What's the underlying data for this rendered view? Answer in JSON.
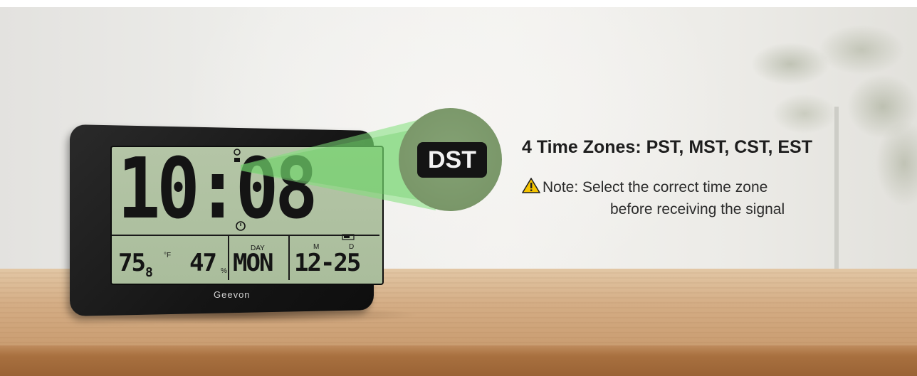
{
  "clock": {
    "time": "10:08",
    "temperature": "75",
    "temperature_decimal": "8",
    "temperature_unit": "°F",
    "humidity": "47",
    "humidity_unit": "%",
    "day_label": "DAY",
    "day": "MON",
    "month_label": "M",
    "day_num_label": "D",
    "date": "12-25",
    "brand": "Geevon"
  },
  "badge": {
    "text": "DST"
  },
  "headline": "4 Time Zones: PST, MST, CST, EST",
  "note": {
    "line1": "Note: Select the correct time zone",
    "line2": "before receiving the signal",
    "icon": "warning-icon"
  },
  "colors": {
    "lcd": "#b4c5a6",
    "lens": "#7a9769",
    "badge": "#141414",
    "warning": "#f5c400"
  }
}
